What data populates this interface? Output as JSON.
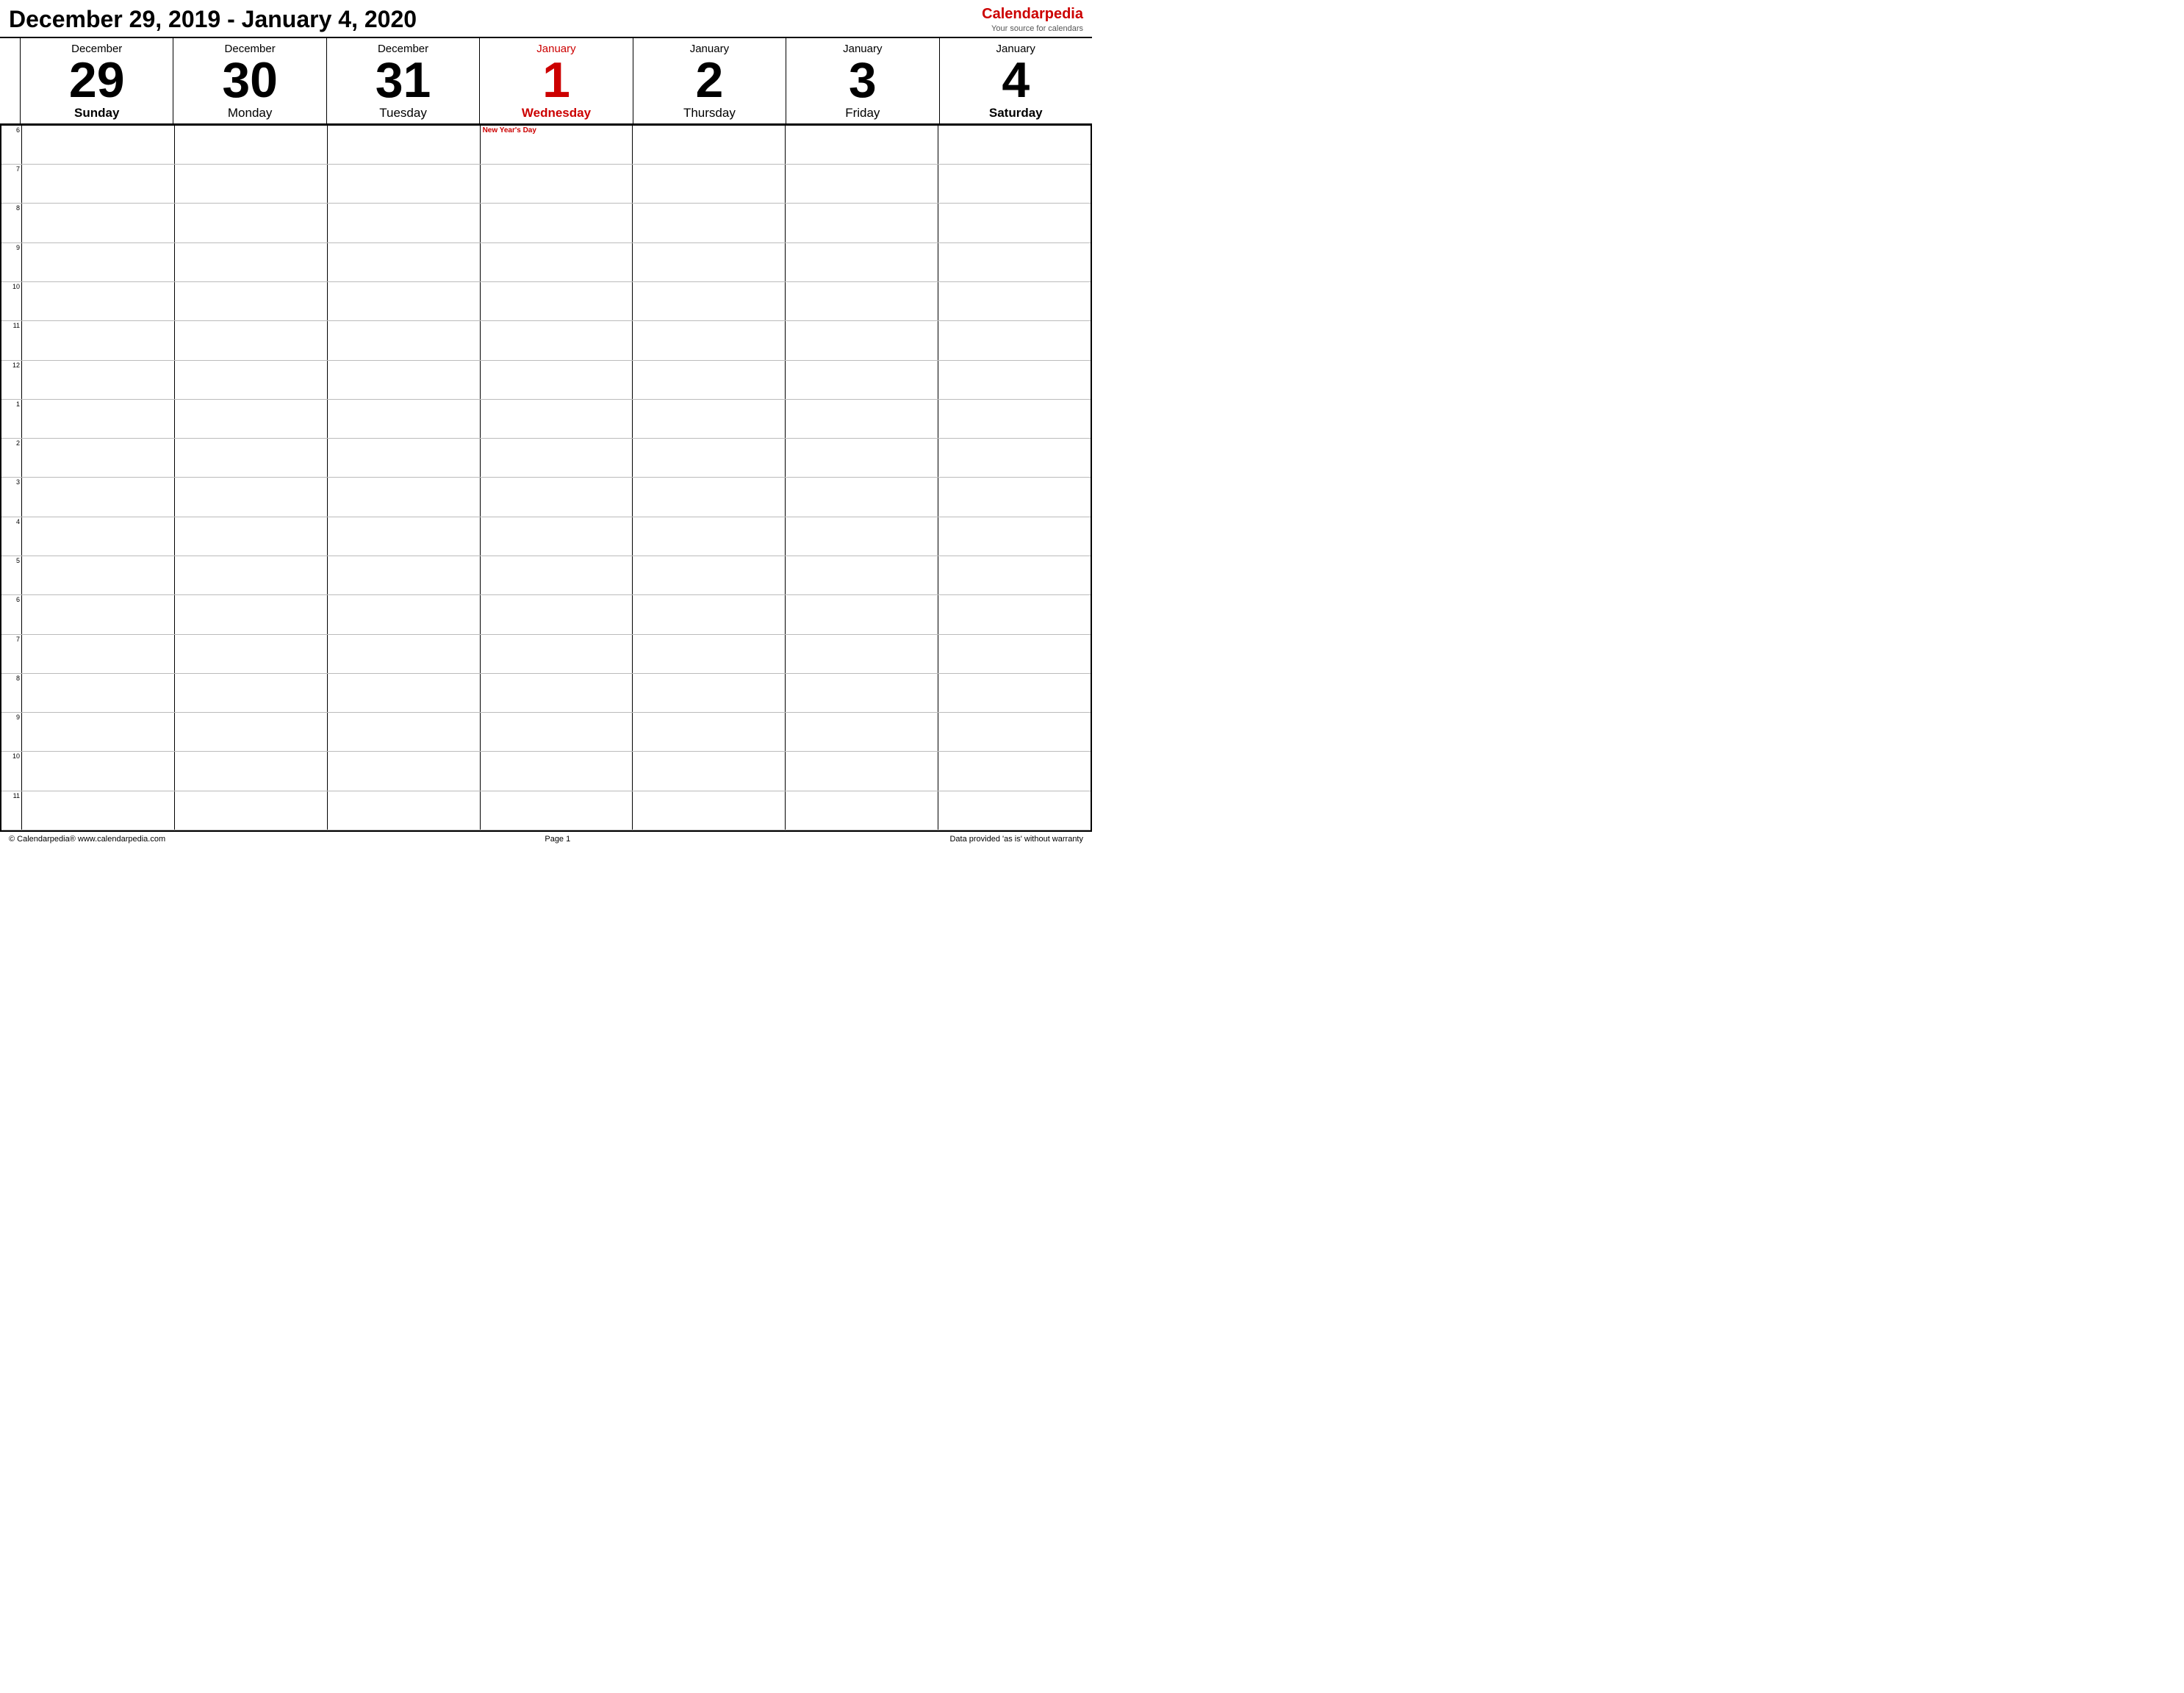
{
  "header": {
    "title": "December 29, 2019 - January 4, 2020",
    "brand_name": "Calendar",
    "brand_name_red": "pedia",
    "brand_tagline": "Your source for calendars"
  },
  "days": [
    {
      "month": "December",
      "number": "29",
      "name": "Sunday",
      "highlight": false,
      "month_red": false,
      "number_red": false,
      "name_bold": true
    },
    {
      "month": "December",
      "number": "30",
      "name": "Monday",
      "highlight": false,
      "month_red": false,
      "number_red": false,
      "name_bold": false
    },
    {
      "month": "December",
      "number": "31",
      "name": "Tuesday",
      "highlight": false,
      "month_red": false,
      "number_red": false,
      "name_bold": false
    },
    {
      "month": "January",
      "number": "1",
      "name": "Wednesday",
      "highlight": true,
      "month_red": true,
      "number_red": true,
      "name_bold": true
    },
    {
      "month": "January",
      "number": "2",
      "name": "Thursday",
      "highlight": false,
      "month_red": false,
      "number_red": false,
      "name_bold": false
    },
    {
      "month": "January",
      "number": "3",
      "name": "Friday",
      "highlight": false,
      "month_red": false,
      "number_red": false,
      "name_bold": false
    },
    {
      "month": "January",
      "number": "4",
      "name": "Saturday",
      "highlight": false,
      "month_red": false,
      "number_red": false,
      "name_bold": true
    }
  ],
  "time_slots": [
    "6",
    "",
    "7",
    "",
    "8",
    "",
    "9",
    "",
    "10",
    "",
    "11",
    "",
    "12",
    "",
    "1",
    "",
    "2",
    "",
    "3",
    "",
    "4",
    "",
    "5",
    "",
    "6",
    "",
    "7",
    "",
    "8",
    "",
    "9",
    "",
    "10",
    "",
    "11",
    ""
  ],
  "time_labels": [
    "6",
    "7",
    "8",
    "9",
    "10",
    "11",
    "12",
    "1",
    "2",
    "3",
    "4",
    "5",
    "6",
    "7",
    "8",
    "9",
    "10",
    "11"
  ],
  "events": {
    "jan1_6am": "New Year's Day"
  },
  "footer": {
    "left": "© Calendarpedia®  www.calendarpedia.com",
    "center": "Page 1",
    "right": "Data provided 'as is' without warranty"
  }
}
